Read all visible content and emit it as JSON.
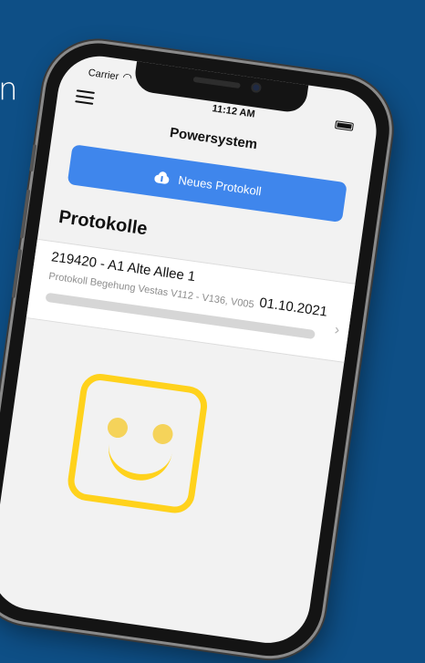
{
  "background_text": "n",
  "status_bar": {
    "carrier": "Carrier",
    "wifi_icon": "wifi-icon",
    "time": "11:12 AM",
    "battery_icon": "battery-icon"
  },
  "header": {
    "menu_icon": "menu-icon",
    "title": "Powersystem"
  },
  "new_button": {
    "icon": "cloud-upload-icon",
    "label": "Neues Protokoll"
  },
  "section": {
    "title": "Protokolle"
  },
  "protocols": [
    {
      "name": "219420 - A1 Alte Allee 1",
      "date": "01.10.2021",
      "description": "Protokoll Begehung Vestas V112 - V136, V005",
      "progress": 0
    }
  ],
  "colors": {
    "background": "#0e4f86",
    "accent": "#3f86ec",
    "smiley": "#ffd21c"
  }
}
